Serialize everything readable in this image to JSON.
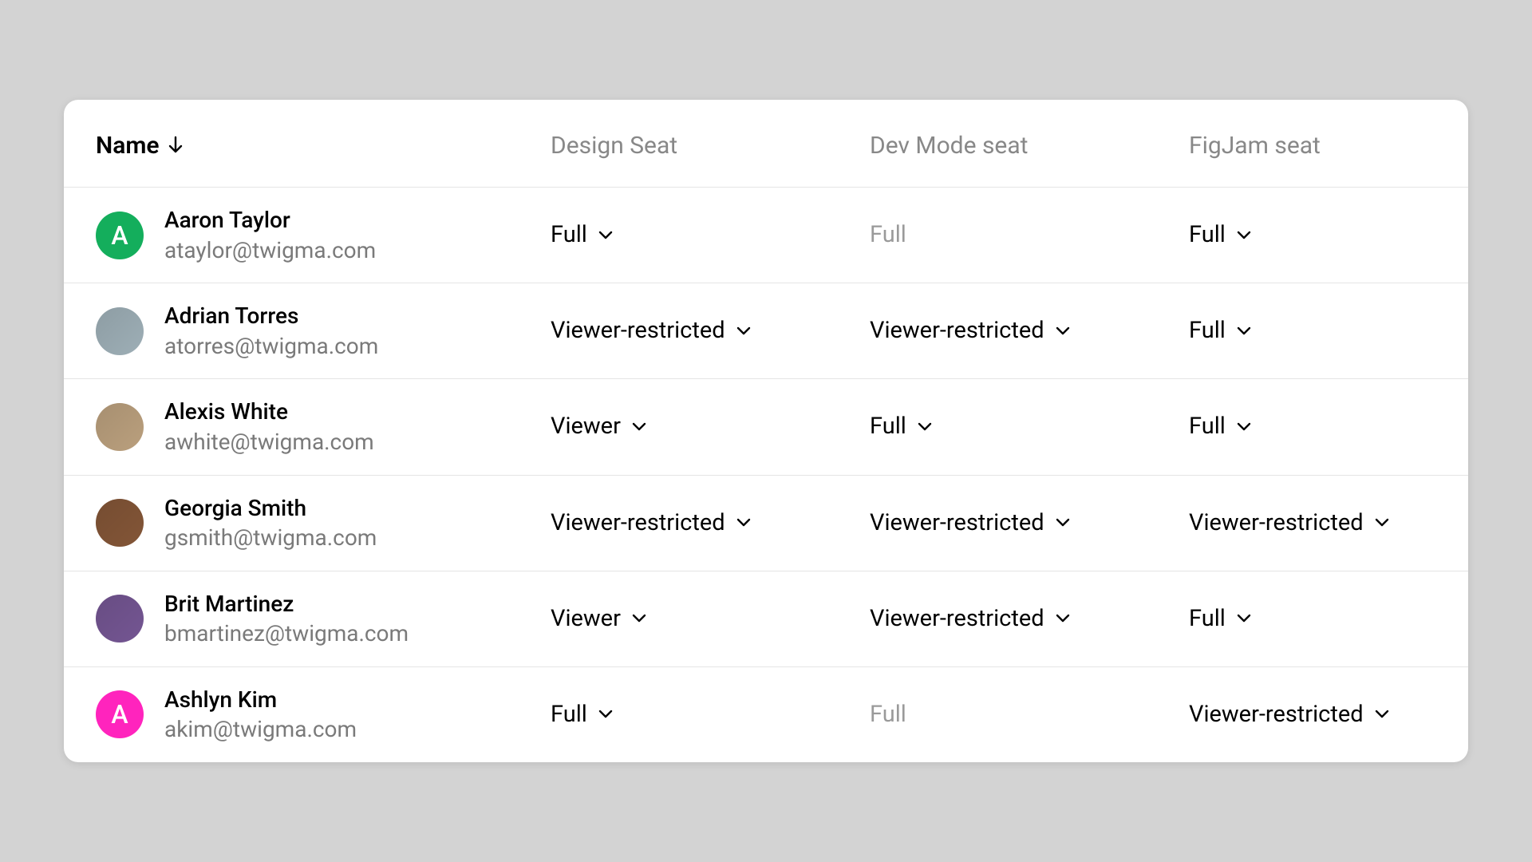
{
  "columns": {
    "name": "Name",
    "design": "Design Seat",
    "devmode": "Dev Mode seat",
    "figjam": "FigJam seat"
  },
  "sort": {
    "column": "name",
    "direction": "asc"
  },
  "seat_values": {
    "full": "Full",
    "viewer": "Viewer",
    "viewer_restricted": "Viewer-restricted"
  },
  "users": [
    {
      "name": "Aaron Taylor",
      "email": "ataylor@twigma.com",
      "avatar": {
        "type": "initial",
        "letter": "A",
        "bg": "#14ae5c"
      },
      "design": {
        "value": "Full",
        "editable": true
      },
      "devmode": {
        "value": "Full",
        "editable": false
      },
      "figjam": {
        "value": "Full",
        "editable": true
      }
    },
    {
      "name": "Adrian Torres",
      "email": "atorres@twigma.com",
      "avatar": {
        "type": "photo",
        "bg": "#a6b8c0"
      },
      "design": {
        "value": "Viewer-restricted",
        "editable": true
      },
      "devmode": {
        "value": "Viewer-restricted",
        "editable": true
      },
      "figjam": {
        "value": "Full",
        "editable": true
      }
    },
    {
      "name": "Alexis White",
      "email": "awhite@twigma.com",
      "avatar": {
        "type": "photo",
        "bg": "#c4a884"
      },
      "design": {
        "value": "Viewer",
        "editable": true
      },
      "devmode": {
        "value": "Full",
        "editable": true
      },
      "figjam": {
        "value": "Full",
        "editable": true
      }
    },
    {
      "name": "Georgia Smith",
      "email": "gsmith@twigma.com",
      "avatar": {
        "type": "photo",
        "bg": "#8a5a3a"
      },
      "design": {
        "value": "Viewer-restricted",
        "editable": true
      },
      "devmode": {
        "value": "Viewer-restricted",
        "editable": true
      },
      "figjam": {
        "value": "Viewer-restricted",
        "editable": true
      }
    },
    {
      "name": "Brit Martinez",
      "email": "bmartinez@twigma.com",
      "avatar": {
        "type": "photo",
        "bg": "#7a5a9a"
      },
      "design": {
        "value": "Viewer",
        "editable": true
      },
      "devmode": {
        "value": "Viewer-restricted",
        "editable": true
      },
      "figjam": {
        "value": "Full",
        "editable": true
      }
    },
    {
      "name": "Ashlyn Kim",
      "email": "akim@twigma.com",
      "avatar": {
        "type": "initial",
        "letter": "A",
        "bg": "#ff24bd"
      },
      "design": {
        "value": "Full",
        "editable": true
      },
      "devmode": {
        "value": "Full",
        "editable": false
      },
      "figjam": {
        "value": "Viewer-restricted",
        "editable": true
      }
    }
  ]
}
